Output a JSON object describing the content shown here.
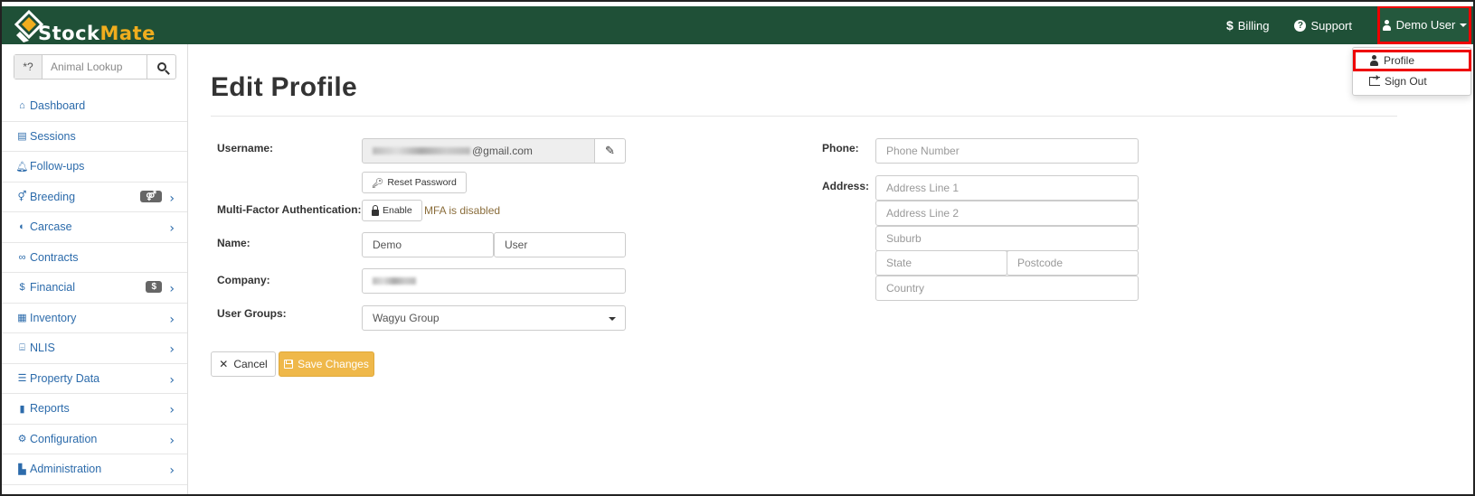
{
  "brand": {
    "name_part1": "Stock",
    "name_part2": "Mate",
    "accent": "#f0ad1e",
    "nav_bg": "#1f5037"
  },
  "navbar": {
    "billing_icon": "$",
    "billing": "Billing",
    "support": "Support",
    "user": "Demo User"
  },
  "user_dropdown": {
    "profile": "Profile",
    "sign_out": "Sign Out"
  },
  "sidebar": {
    "lookup_prefix": "*?",
    "lookup_placeholder": "Animal Lookup",
    "items": [
      {
        "label": "Dashboard",
        "icon": "home-icon"
      },
      {
        "label": "Sessions",
        "icon": "table-icon"
      },
      {
        "label": "Follow-ups",
        "icon": "bell-icon"
      },
      {
        "label": "Breeding",
        "icon": "gender-icon",
        "badge": "⚤"
      },
      {
        "label": "Carcase",
        "icon": "meat-icon"
      },
      {
        "label": "Contracts",
        "icon": "handshake-icon"
      },
      {
        "label": "Financial",
        "icon": "dollar-icon",
        "badge": "$"
      },
      {
        "label": "Inventory",
        "icon": "boxes-icon"
      },
      {
        "label": "NLIS",
        "icon": "bank-icon"
      },
      {
        "label": "Property Data",
        "icon": "sliders-icon"
      },
      {
        "label": "Reports",
        "icon": "chart-icon"
      },
      {
        "label": "Configuration",
        "icon": "gear-icon"
      },
      {
        "label": "Administration",
        "icon": "building-icon"
      }
    ]
  },
  "page": {
    "title": "Edit Profile",
    "labels": {
      "username": "Username:",
      "mfa": "Multi-Factor Authentication:",
      "name": "Name:",
      "company": "Company:",
      "user_groups": "User Groups:",
      "phone": "Phone:",
      "address": "Address:"
    },
    "username_domain": "@gmail.com",
    "reset_password": "Reset Password",
    "mfa_enable": "Enable",
    "mfa_status": "MFA is disabled",
    "first_name": "Demo",
    "last_name": "User",
    "user_group": "Wagyu Group",
    "placeholders": {
      "phone": "Phone Number",
      "address1": "Address Line 1",
      "address2": "Address Line 2",
      "suburb": "Suburb",
      "state": "State",
      "postcode": "Postcode",
      "country": "Country"
    },
    "cancel": "Cancel",
    "save": "Save Changes"
  }
}
